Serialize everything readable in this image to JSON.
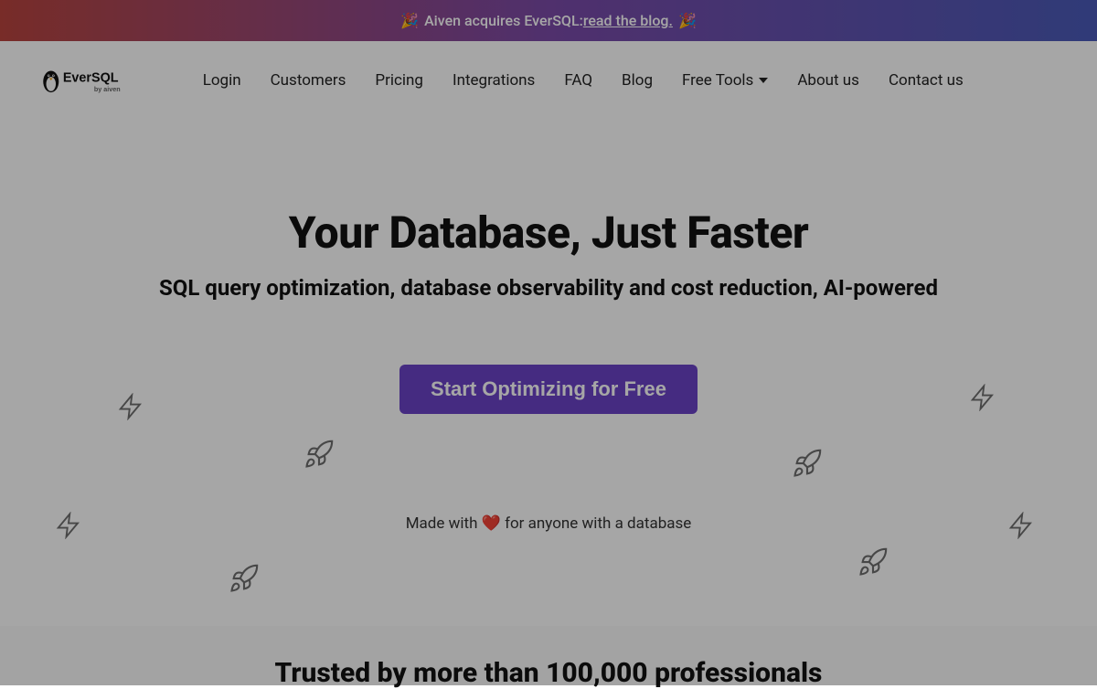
{
  "banner": {
    "emoji": "🎉",
    "prefix": "Aiven acquires EverSQL: ",
    "link_text": "read the blog."
  },
  "logo": {
    "brand": "EverSQL",
    "byline": "by aiven"
  },
  "nav": {
    "login": "Login",
    "customers": "Customers",
    "pricing": "Pricing",
    "integrations": "Integrations",
    "faq": "FAQ",
    "blog": "Blog",
    "free_tools": "Free Tools",
    "about_us": "About us",
    "contact_us": "Contact us"
  },
  "hero": {
    "title": "Your Database, Just Faster",
    "subtitle": "SQL query optimization, database observability and cost reduction, AI-powered",
    "cta": "Start Optimizing for Free",
    "made_with_prefix": "Made with",
    "heart": "❤️",
    "made_with_suffix": " for anyone with a database"
  },
  "trusted": {
    "title": "Trusted by more than 100,000 professionals"
  },
  "colors": {
    "accent": "#6a43c7",
    "banner_left": "#b8443e",
    "banner_right": "#4a5ab8"
  }
}
